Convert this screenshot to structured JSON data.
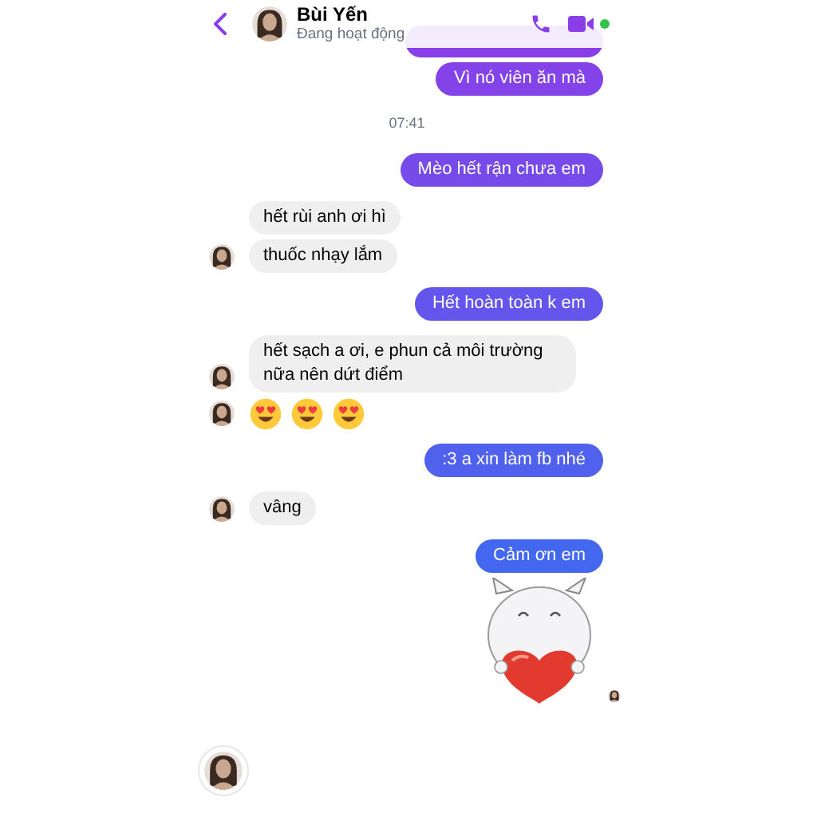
{
  "header": {
    "name": "Bùi Yến",
    "status": "Đang hoạt động",
    "active": true
  },
  "messages": [
    {
      "kind": "cut_bubble",
      "outgoing": true
    },
    {
      "kind": "text",
      "outgoing": true,
      "text": "Vì nó viên ăn mà"
    },
    {
      "kind": "time",
      "text": "07:41"
    },
    {
      "kind": "text",
      "outgoing": true,
      "text": "Mèo hết rận chưa em"
    },
    {
      "kind": "text",
      "outgoing": false,
      "text": "hết rùi anh ơi hì",
      "avatar": false
    },
    {
      "kind": "text",
      "outgoing": false,
      "text": "thuốc nhạy lắm",
      "avatar": true
    },
    {
      "kind": "text",
      "outgoing": true,
      "text": "Hết hoàn toàn k em"
    },
    {
      "kind": "text",
      "outgoing": false,
      "text": "hết sạch a ơi, e phun cả môi trường nữa nên dứt điểm",
      "avatar": true
    },
    {
      "kind": "emojis",
      "outgoing": false,
      "avatar": true
    },
    {
      "kind": "text",
      "outgoing": true,
      "text": ":3 a xin làm fb nhé"
    },
    {
      "kind": "text",
      "outgoing": false,
      "text": "vâng",
      "avatar": true
    },
    {
      "kind": "text",
      "outgoing": true,
      "text": "Cảm ơn em"
    },
    {
      "kind": "sticker",
      "outgoing": true,
      "seen": true
    }
  ]
}
